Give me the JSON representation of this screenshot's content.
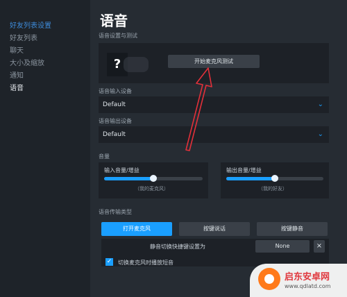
{
  "sidebar": {
    "header": "好友列表设置",
    "items": [
      {
        "label": "好友列表"
      },
      {
        "label": "聊天"
      },
      {
        "label": "大小及缩放"
      },
      {
        "label": "通知"
      },
      {
        "label": "语音"
      }
    ]
  },
  "page": {
    "title": "语音"
  },
  "test_section": {
    "label": "语音设置与测试",
    "question_mark": "?",
    "test_button": "开始麦克风测试"
  },
  "input_device": {
    "label": "语音输入设备",
    "value": "Default"
  },
  "output_device": {
    "label": "语音输出设备",
    "value": "Default"
  },
  "volume": {
    "label": "音量",
    "input": {
      "label": "输入音量/增益",
      "caption": "（我的麦克风）",
      "level": 0.5
    },
    "output": {
      "label": "输出音量/增益",
      "caption": "（我的好友）",
      "level": 0.5
    }
  },
  "transmission": {
    "label": "语音传输类型",
    "tabs": [
      "打开麦克风",
      "按键说话",
      "按键静音"
    ],
    "active_tab": 0,
    "mute_hotkey_label": "静音切换快捷键设置为",
    "mute_hotkey_value": "None",
    "clear_button": "×",
    "play_sound_label": "切换麦克风时播放短音",
    "play_sound_checked": true
  },
  "watermark": {
    "brand": "启东安卓网",
    "url": "www.qdlatd.com"
  },
  "colors": {
    "accent": "#1a9fff",
    "arrow": "#e3303a",
    "background": "#262c33"
  }
}
